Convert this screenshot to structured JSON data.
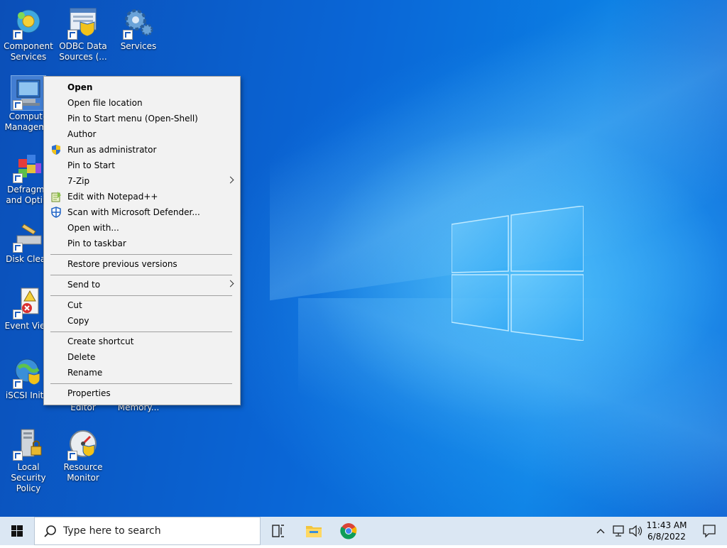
{
  "desktop": {
    "icons": [
      {
        "name": "component-services",
        "label": "Component Services"
      },
      {
        "name": "odbc-data-sources",
        "label": "ODBC Data Sources (..."
      },
      {
        "name": "services",
        "label": "Services"
      },
      {
        "name": "computer-management",
        "label": "Compute Manageme"
      },
      {
        "name": "defragment",
        "label": "Defragme and Optim"
      },
      {
        "name": "disk-cleanup",
        "label": "Disk Clean"
      },
      {
        "name": "event-viewer",
        "label": "Event View"
      },
      {
        "name": "iscsi-initiator",
        "label": "iSCSI Initia"
      },
      {
        "name": "registry-editor",
        "label": "Editor"
      },
      {
        "name": "memory-diagnostic",
        "label": "Memory..."
      },
      {
        "name": "local-security-policy",
        "label": "Local Security Policy"
      },
      {
        "name": "resource-monitor",
        "label": "Resource Monitor"
      }
    ]
  },
  "context_menu": {
    "items": [
      {
        "label": "Open",
        "bold": true
      },
      {
        "label": "Open file location"
      },
      {
        "label": "Pin to Start menu (Open-Shell)"
      },
      {
        "label": "Author"
      },
      {
        "label": "Run as administrator",
        "icon": "uac-shield-icon"
      },
      {
        "label": "Pin to Start"
      },
      {
        "label": "7-Zip",
        "submenu": true
      },
      {
        "label": "Edit with Notepad++",
        "icon": "notepadpp-icon"
      },
      {
        "label": "Scan with Microsoft Defender...",
        "icon": "defender-icon"
      },
      {
        "label": "Open with..."
      },
      {
        "label": "Pin to taskbar"
      },
      {
        "label": "Restore previous versions"
      },
      {
        "label": "Send to",
        "submenu": true
      },
      {
        "label": "Cut"
      },
      {
        "label": "Copy"
      },
      {
        "label": "Create shortcut"
      },
      {
        "label": "Delete"
      },
      {
        "label": "Rename"
      },
      {
        "label": "Properties"
      }
    ]
  },
  "taskbar": {
    "search_placeholder": "Type here to search",
    "time": "11:43 AM",
    "date": "6/8/2022",
    "pinned": [
      "task-view-icon",
      "file-explorer-icon",
      "chrome-icon"
    ],
    "tray": [
      "chevron-up-icon",
      "network-icon",
      "volume-icon"
    ]
  }
}
